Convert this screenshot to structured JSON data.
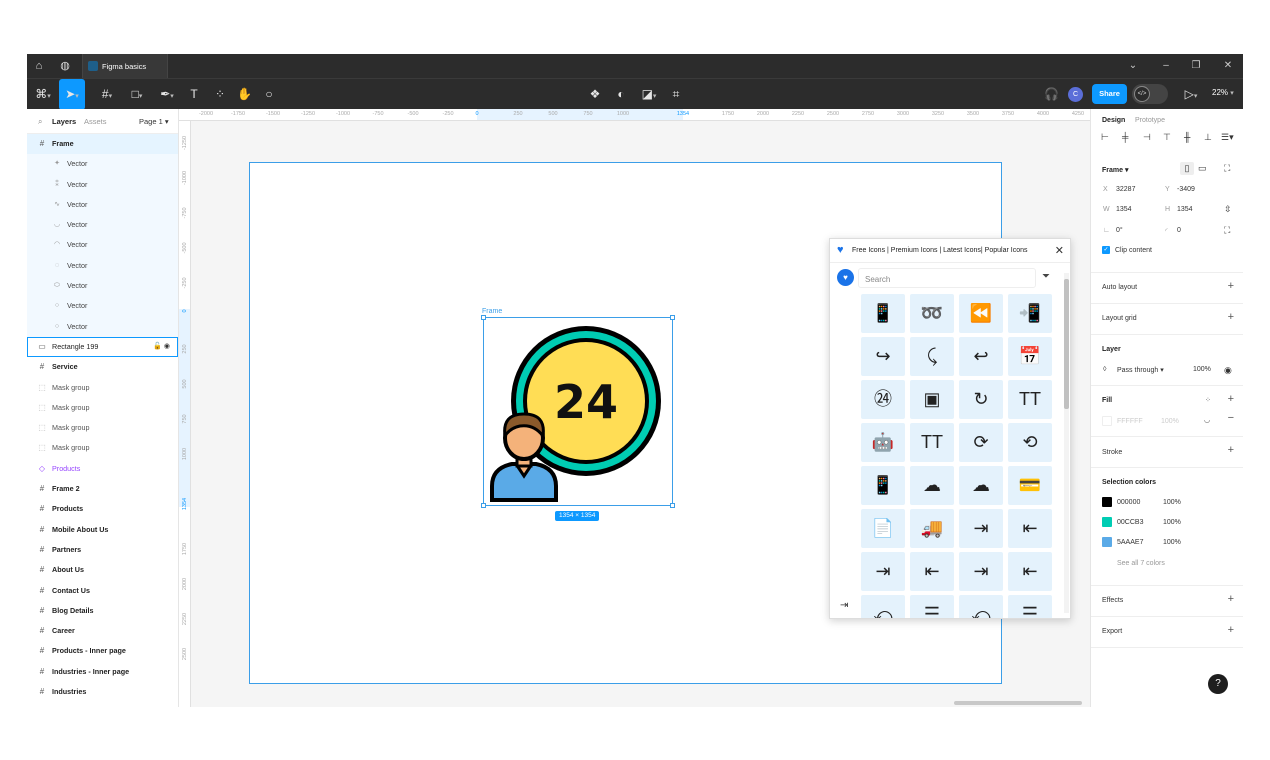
{
  "window": {
    "tab_title": "Figma basics"
  },
  "toolbar": {
    "share_label": "Share",
    "avatar_initial": "C",
    "zoom": "22%"
  },
  "layers_panel": {
    "tab_layers": "Layers",
    "tab_assets": "Assets",
    "page": "Page 1",
    "items": [
      {
        "label": "Frame",
        "icon": "#",
        "kind": "frame-selected"
      },
      {
        "label": "Vector",
        "icon": "✦",
        "kind": "child"
      },
      {
        "label": "Vector",
        "icon": "⁑",
        "kind": "child"
      },
      {
        "label": "Vector",
        "icon": "∿",
        "kind": "child"
      },
      {
        "label": "Vector",
        "icon": "◡",
        "kind": "child"
      },
      {
        "label": "Vector",
        "icon": "◠",
        "kind": "child"
      },
      {
        "label": "Vector",
        "icon": "◌",
        "kind": "child"
      },
      {
        "label": "Vector",
        "icon": "⬭",
        "kind": "child"
      },
      {
        "label": "Vector",
        "icon": "○",
        "kind": "child"
      },
      {
        "label": "Vector",
        "icon": "○",
        "kind": "child"
      },
      {
        "label": "Rectangle 199",
        "icon": "▭",
        "kind": "rect"
      },
      {
        "label": "Service",
        "icon": "#",
        "kind": "bold"
      },
      {
        "label": "Mask group",
        "icon": "⬚",
        "kind": "gray"
      },
      {
        "label": "Mask group",
        "icon": "⬚",
        "kind": "gray"
      },
      {
        "label": "Mask group",
        "icon": "⬚",
        "kind": "gray"
      },
      {
        "label": "Mask group",
        "icon": "⬚",
        "kind": "gray"
      },
      {
        "label": "Products",
        "icon": "◇",
        "kind": "purple"
      },
      {
        "label": "Frame 2",
        "icon": "#",
        "kind": "bold"
      },
      {
        "label": "Products",
        "icon": "#",
        "kind": "bold"
      },
      {
        "label": "Mobile About Us",
        "icon": "#",
        "kind": "bold"
      },
      {
        "label": "Partners",
        "icon": "#",
        "kind": "bold"
      },
      {
        "label": "About Us",
        "icon": "#",
        "kind": "bold"
      },
      {
        "label": "Contact Us",
        "icon": "#",
        "kind": "bold"
      },
      {
        "label": "Blog Details",
        "icon": "#",
        "kind": "bold"
      },
      {
        "label": "Career",
        "icon": "#",
        "kind": "bold"
      },
      {
        "label": "Products - Inner page",
        "icon": "#",
        "kind": "bold"
      },
      {
        "label": "Industries - Inner page",
        "icon": "#",
        "kind": "bold"
      },
      {
        "label": "Industries",
        "icon": "#",
        "kind": "bold"
      }
    ]
  },
  "rulers": {
    "top": [
      "-2000",
      "-1750",
      "-1500",
      "-1250",
      "-1000",
      "-750",
      "-500",
      "-250",
      "0",
      "250",
      "500",
      "750",
      "1000",
      "1354",
      "1750",
      "2000",
      "2250",
      "2500",
      "2750",
      "3000",
      "3250",
      "3500",
      "3750",
      "4000",
      "4250"
    ],
    "left": [
      "-1250",
      "-1000",
      "-750",
      "-500",
      "-250",
      "0",
      "250",
      "500",
      "750",
      "1000",
      "1354",
      "1750",
      "2000",
      "2250",
      "2500"
    ]
  },
  "canvas": {
    "frame_label": "Frame",
    "size_badge": "1354 × 1354",
    "artwork_number": "24"
  },
  "plugin": {
    "title": "Free Icons | Premium Icons | Latest Icons| Popular Icons",
    "search_placeholder": "Search",
    "icons": [
      "mobile-shield-icon",
      "arrow-forward-icon",
      "double-arrow-left-icon",
      "mobile-message-icon",
      "arrow-redo-icon",
      "dotted-arrow-icon",
      "green-arrow-icon",
      "calendar-icon",
      "support-24-icon",
      "square-tile-icon",
      "red-refresh-icon",
      "text-type-icon",
      "robot-icon",
      "text-type-outline-icon",
      "clock-24-icon",
      "history-24-icon",
      "mobile-app-icon",
      "cloud-24-icon",
      "cloud-clock-icon",
      "mobile-card-icon",
      "document-warning-icon",
      "truck-24-icon",
      "indent-right-icon",
      "indent-left-icon",
      "indent-bold-right-icon",
      "indent-bold-left-icon",
      "indent-bold-right-2-icon",
      "indent-bold-left-2-icon",
      "reply-all-icon",
      "align-text-icon",
      "reply-back-icon",
      "text-lines-icon"
    ],
    "glyphs": [
      "📱",
      "➿",
      "⏪",
      "📲",
      "↪",
      "⤹",
      "↩",
      "📅",
      "㉔",
      "▣",
      "↻",
      "TT",
      "🤖",
      "TT",
      "⟳",
      "⟲",
      "📱",
      "☁",
      "☁",
      "💳",
      "📄",
      "🚚",
      "⇥",
      "⇤",
      "⇥",
      "⇤",
      "⇥",
      "⇤",
      "⤺",
      "☰",
      "⤺",
      "☰"
    ]
  },
  "design_panel": {
    "tab_design": "Design",
    "tab_prototype": "Prototype",
    "frame_label": "Frame",
    "x_label": "X",
    "x": "32287",
    "y_label": "Y",
    "y": "-3409",
    "w_label": "W",
    "w": "1354",
    "h_label": "H",
    "h": "1354",
    "rotation": "0°",
    "radius": "0",
    "clip_content": "Clip content",
    "auto_layout": "Auto layout",
    "layout_grid": "Layout grid",
    "layer_title": "Layer",
    "blend": "Pass through",
    "opacity": "100%",
    "fill_title": "Fill",
    "fill_hex": "FFFFFF",
    "fill_opacity": "100%",
    "stroke": "Stroke",
    "selection_colors_title": "Selection colors",
    "selection_colors": [
      {
        "hex": "000000",
        "opacity": "100%",
        "color": "#000000"
      },
      {
        "hex": "00CCB3",
        "opacity": "100%",
        "color": "#00CCB3"
      },
      {
        "hex": "5AAAE7",
        "opacity": "100%",
        "color": "#5AAAE7"
      }
    ],
    "see_all": "See all 7 colors",
    "effects": "Effects",
    "export": "Export"
  },
  "help_label": "?",
  "colors": {
    "accent": "#0d99ff",
    "toolbar_bg": "#2c2c2c"
  }
}
